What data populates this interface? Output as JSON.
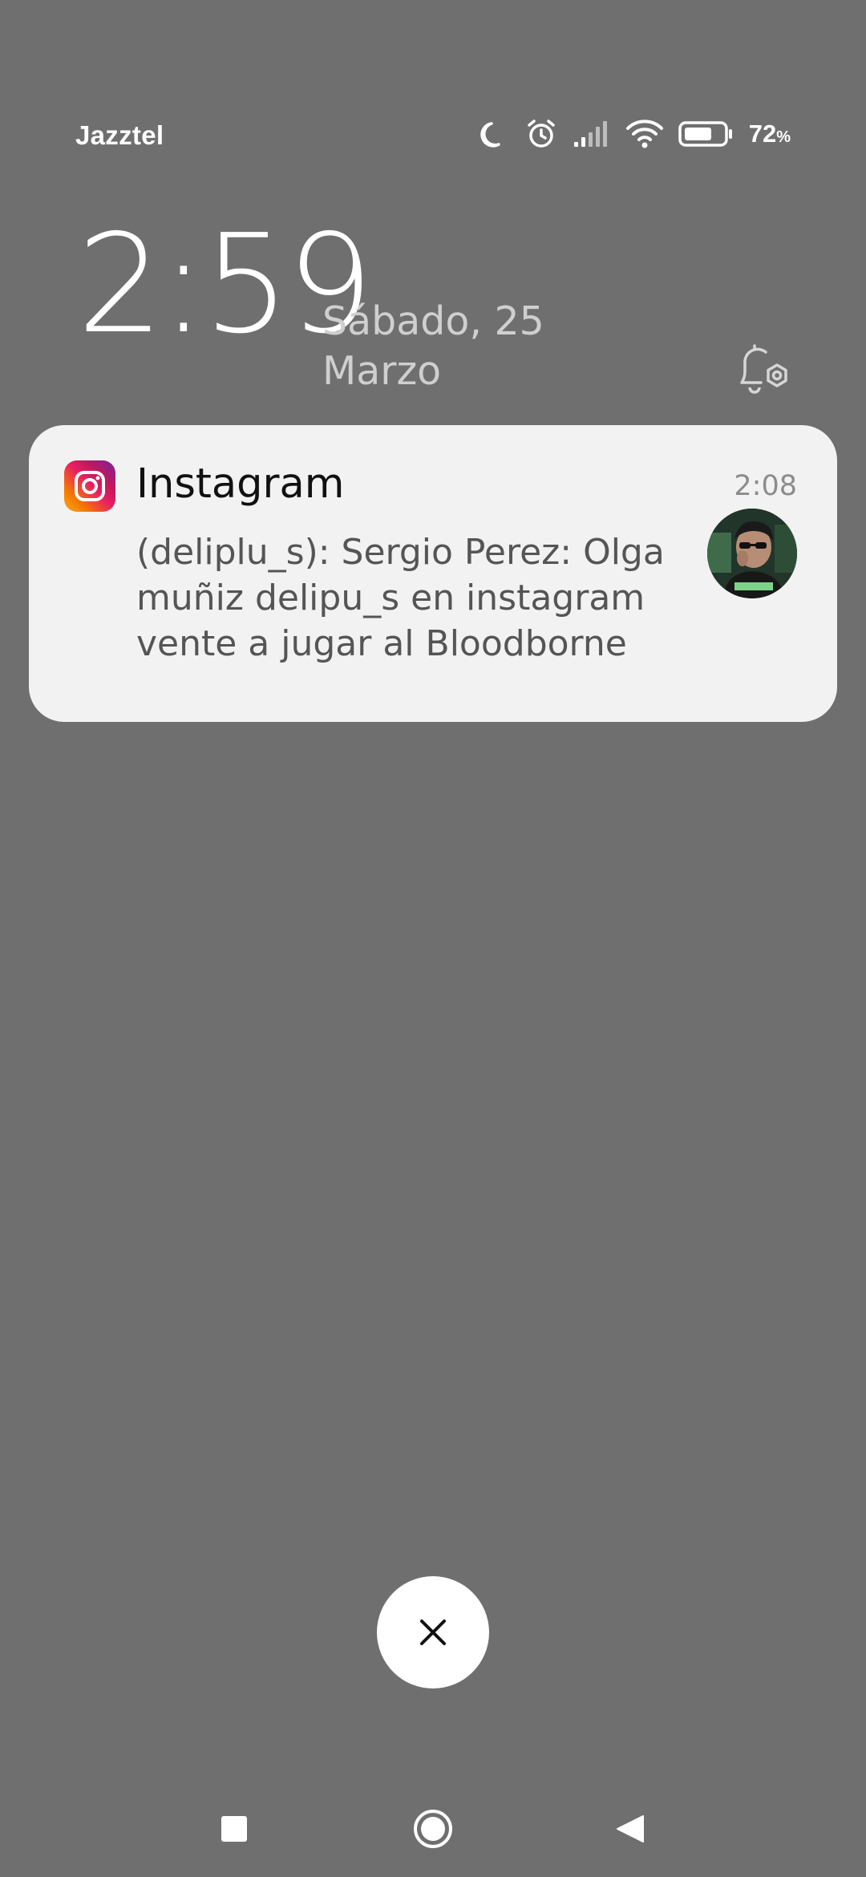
{
  "status_bar": {
    "carrier": "Jazztel",
    "battery_percent": "72",
    "battery_percent_sign": "%",
    "battery_level": 0.72,
    "icons": [
      "moon-icon",
      "alarm-icon",
      "signal-icon",
      "wifi-icon",
      "battery-icon"
    ]
  },
  "lockscreen": {
    "time": "2:59",
    "date_line1": "Sábado, 25",
    "date_line2": "Marzo"
  },
  "notification": {
    "app_name": "Instagram",
    "time": "2:08",
    "body_line1": "(deliplu_s): Sergio Perez: Olga",
    "body_line2": "muñiz delipu_s en instagram",
    "body_line3": "vente a jugar al Bloodborne"
  },
  "colors": {
    "background": "#6f6f6f",
    "card": "#f2f2f2",
    "date_text": "#cfcfcf"
  }
}
